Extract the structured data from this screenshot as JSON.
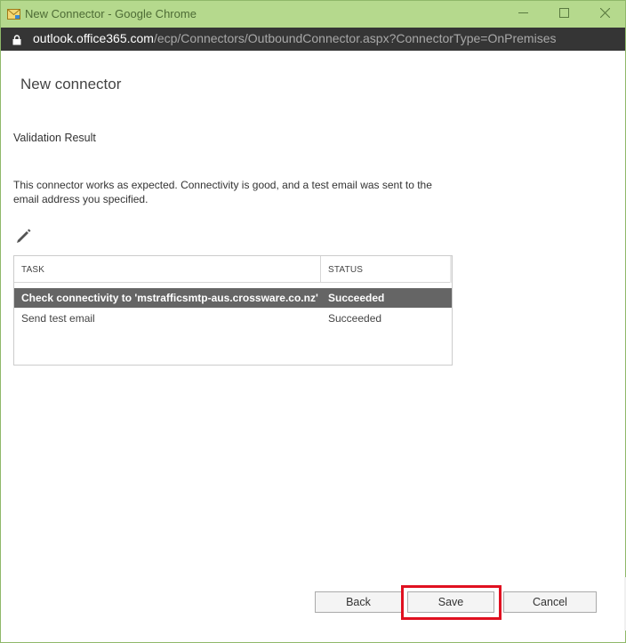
{
  "window": {
    "title": "New Connector - Google Chrome",
    "title_bar_color": "#b5d98d"
  },
  "address_bar": {
    "domain": "outlook.office365.com",
    "path": "/ecp/Connectors/OutboundConnector.aspx?ConnectorType=OnPremises"
  },
  "page": {
    "title": "New connector",
    "section_heading": "Validation Result",
    "message": "This connector works as expected. Connectivity is good, and a test email was sent to the email address you specified."
  },
  "grid": {
    "columns": [
      "TASK",
      "STATUS"
    ],
    "rows": [
      {
        "task": "Check connectivity to 'mstrafficsmtp-aus.crossware.co.nz'",
        "status": "Succeeded",
        "selected": true
      },
      {
        "task": "Send test email",
        "status": "Succeeded",
        "selected": false
      }
    ],
    "selected_row_color": "#656565"
  },
  "buttons": {
    "back": "Back",
    "save": "Save",
    "cancel": "Cancel"
  },
  "icons": {
    "app": "envelope-icon",
    "lock": "lock-icon",
    "edit": "pencil-icon",
    "minimize": "minimize-icon",
    "maximize": "maximize-icon",
    "close": "close-icon"
  },
  "highlight_color": "#e01020"
}
